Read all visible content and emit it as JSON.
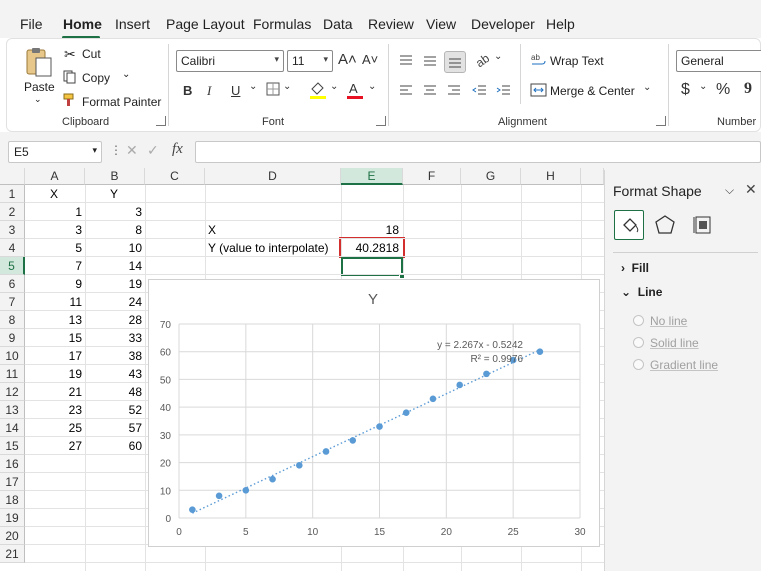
{
  "menu": {
    "tabs": [
      "File",
      "Home",
      "Insert",
      "Page Layout",
      "Formulas",
      "Data",
      "Review",
      "View",
      "Developer",
      "Help"
    ],
    "active": "Home"
  },
  "ribbon": {
    "clipboard": {
      "paste": "Paste",
      "cut": "Cut",
      "copy": "Copy",
      "format_painter": "Format Painter",
      "label": "Clipboard"
    },
    "font": {
      "name": "Calibri",
      "size": "11",
      "bold": "B",
      "italic": "I",
      "underline": "U",
      "grow": "A˄",
      "shrink": "A˅",
      "label": "Font",
      "fill_color": "#ffff00",
      "font_color": "#e81123"
    },
    "alignment": {
      "wrap_text": "Wrap Text",
      "merge_center": "Merge & Center",
      "label": "Alignment"
    },
    "number": {
      "format": "General",
      "currency": "$",
      "percent": "%",
      "comma": "9",
      "label": "Number"
    }
  },
  "formula_bar": {
    "name_box": "E5",
    "fx": "fx",
    "formula": ""
  },
  "sheet": {
    "columns": [
      "A",
      "B",
      "C",
      "D",
      "E",
      "F",
      "G",
      "H"
    ],
    "selected_column": "E",
    "selected_row": "5",
    "rows": [
      "1",
      "2",
      "3",
      "4",
      "5",
      "6",
      "7",
      "8",
      "9",
      "10",
      "11",
      "12",
      "13",
      "14",
      "15",
      "16",
      "17",
      "18",
      "19",
      "20",
      "21"
    ],
    "headers": {
      "A1": "X",
      "B1": "Y"
    },
    "table_x": [
      "1",
      "3",
      "5",
      "7",
      "9",
      "11",
      "13",
      "15",
      "17",
      "19",
      "21",
      "23",
      "25",
      "27"
    ],
    "table_y": [
      "3",
      "8",
      "10",
      "14",
      "19",
      "24",
      "28",
      "33",
      "38",
      "43",
      "48",
      "52",
      "57",
      "60"
    ],
    "interp": {
      "x_label": "X",
      "x_value": "18",
      "y_label": "Y (value to interpolate)",
      "y_value": "40.2818"
    }
  },
  "chart_data": {
    "type": "scatter",
    "title": "Y",
    "x": [
      1,
      3,
      5,
      7,
      9,
      11,
      13,
      15,
      17,
      19,
      21,
      23,
      25,
      27
    ],
    "y": [
      3,
      8,
      10,
      14,
      19,
      24,
      28,
      33,
      38,
      43,
      48,
      52,
      57,
      60
    ],
    "trendline": {
      "type": "linear",
      "slope": 2.267,
      "intercept": -0.5242,
      "style": "dotted"
    },
    "equation_label": "y = 2.267x - 0.5242",
    "r2_label": "R² = 0.9976",
    "xlim": [
      0,
      30
    ],
    "ylim": [
      0,
      70
    ],
    "x_ticks": [
      "0",
      "5",
      "10",
      "15",
      "20",
      "25",
      "30"
    ],
    "y_ticks": [
      "0",
      "10",
      "20",
      "30",
      "40",
      "50",
      "60",
      "70"
    ],
    "grid": true,
    "marker_color": "#5b9bd5"
  },
  "format_pane": {
    "title": "Format Shape",
    "fill": "Fill",
    "line": "Line",
    "options": [
      "No line",
      "Solid line",
      "Gradient line"
    ]
  }
}
